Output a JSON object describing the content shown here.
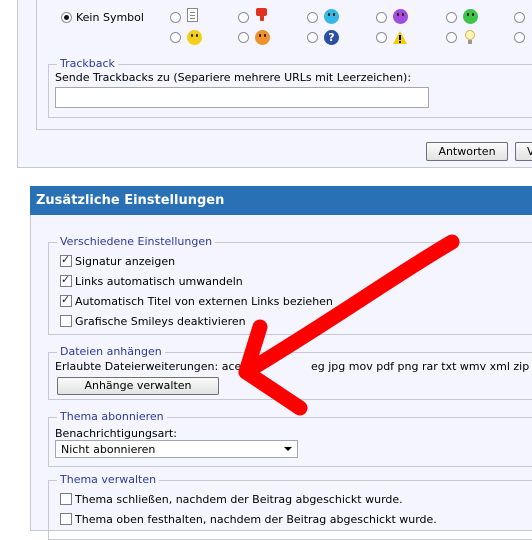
{
  "symbols": {
    "no_symbol_label": "Kein Symbol",
    "selected": "kein-symbol",
    "icons_row1": [
      "document-icon",
      "thumbs-down-icon",
      "smile-blue-icon",
      "smile-purple-icon",
      "grin-green-icon"
    ],
    "icons_row2": [
      "smile-yellow-icon",
      "smile-orange-icon",
      "question-icon",
      "warning-icon",
      "lightbulb-icon"
    ]
  },
  "trackback": {
    "legend": "Trackback",
    "label": "Sende Trackbacks zu (Separiere mehrere URLs mit Leerzeichen):",
    "value": ""
  },
  "form_buttons": {
    "reply_label": "Antworten",
    "second_label": "V"
  },
  "extra": {
    "title": "Zusätzliche Einstellungen",
    "misc": {
      "legend": "Verschiedene Einstellungen",
      "options": [
        {
          "label": "Signatur anzeigen",
          "checked": true
        },
        {
          "label": "Links automatisch umwandeln",
          "checked": true
        },
        {
          "label": "Automatisch Titel von externen Links beziehen",
          "checked": true
        },
        {
          "label": "Grafische Smileys deaktivieren",
          "checked": false
        }
      ]
    },
    "attachments": {
      "legend": "Dateien anhängen",
      "allowed_prefix": "Erlaubte Dateierweiterungen: ace",
      "allowed_suffix": "eg jpg mov pdf png rar txt wmv xml zip",
      "manage_button": "Anhänge verwalten"
    },
    "subscribe": {
      "legend": "Thema abonnieren",
      "label": "Benachrichtigungsart:",
      "selected": "Nicht abonnieren"
    },
    "manage": {
      "legend": "Thema verwalten",
      "options": [
        {
          "label": "Thema schließen, nachdem der Beitrag abgeschickt wurde.",
          "checked": false
        },
        {
          "label": "Thema oben festhalten, nachdem der Beitrag abgeschickt wurde.",
          "checked": false
        }
      ]
    }
  },
  "colors": {
    "header_bg": "#2a70b5",
    "panel_bg": "#f5f5ff",
    "legend_text": "#2d3b9c",
    "annotation_arrow": "#ff0000"
  }
}
